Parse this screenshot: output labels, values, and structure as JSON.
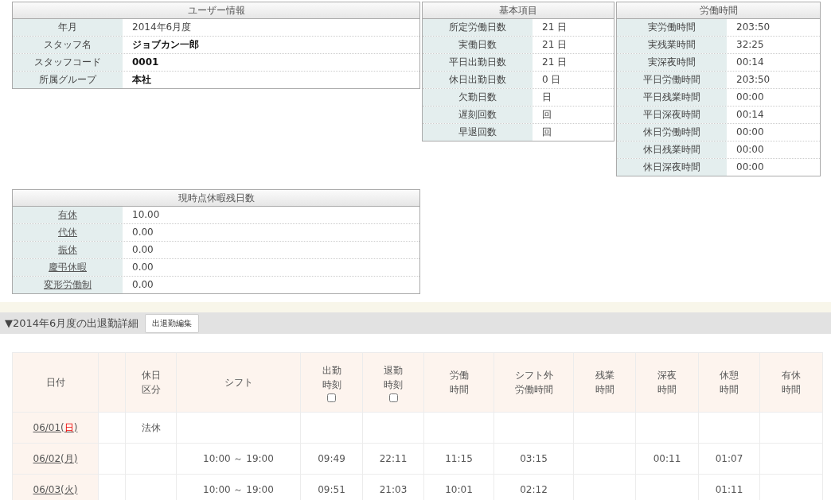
{
  "user_info": {
    "title": "ユーザー情報",
    "rows": [
      {
        "label": "年月",
        "value": "2014年6月度",
        "emphasized": false
      },
      {
        "label": "スタッフ名",
        "value": "ジョブカン一郎",
        "emphasized": true
      },
      {
        "label": "スタッフコード",
        "value": "0001",
        "emphasized": true
      },
      {
        "label": "所属グループ",
        "value": "本社",
        "emphasized": true
      }
    ]
  },
  "basic_items": {
    "title": "基本項目",
    "rows": [
      {
        "label": "所定労働日数",
        "value": "21 日"
      },
      {
        "label": "実働日数",
        "value": "21 日"
      },
      {
        "label": "平日出勤日数",
        "value": "21 日"
      },
      {
        "label": "休日出勤日数",
        "value": "0 日"
      },
      {
        "label": "欠勤日数",
        "value": "日"
      },
      {
        "label": "遅刻回数",
        "value": "回"
      },
      {
        "label": "早退回数",
        "value": "回"
      }
    ]
  },
  "working_hours": {
    "title": "労働時間",
    "rows": [
      {
        "label": "実労働時間",
        "value": "203:50"
      },
      {
        "label": "実残業時間",
        "value": "32:25"
      },
      {
        "label": "実深夜時間",
        "value": "00:14"
      },
      {
        "label": "平日労働時間",
        "value": "203:50"
      },
      {
        "label": "平日残業時間",
        "value": "00:00"
      },
      {
        "label": "平日深夜時間",
        "value": "00:14"
      },
      {
        "label": "休日労働時間",
        "value": "00:00"
      },
      {
        "label": "休日残業時間",
        "value": "00:00"
      },
      {
        "label": "休日深夜時間",
        "value": "00:00"
      }
    ]
  },
  "leave_balance": {
    "title": "現時点休暇残日数",
    "rows": [
      {
        "label": "有休",
        "value": "10.00"
      },
      {
        "label": "代休",
        "value": "0.00"
      },
      {
        "label": "振休",
        "value": "0.00"
      },
      {
        "label": "慶弔休暇",
        "value": "0.00"
      },
      {
        "label": "変形労働制",
        "value": "0.00"
      }
    ]
  },
  "attendance_section": {
    "title": "▼2014年6月度の出退勤詳細",
    "button": "出退勤編集"
  },
  "attendance_table": {
    "columns": [
      {
        "label": "日付"
      },
      {},
      {
        "label": "休日区分"
      },
      {
        "label": "シフト"
      },
      {
        "label": "出勤時刻",
        "checkbox": {
          "checked": false
        }
      },
      {
        "label": "退勤時刻",
        "checkbox": {
          "checked": false
        }
      },
      {
        "label": "労働時間"
      },
      {
        "label": "シフト外労働時間"
      },
      {
        "label": "残業時間"
      },
      {
        "label": "深夜時間"
      },
      {
        "label": "休憩時間"
      },
      {
        "label": "有休時間"
      }
    ],
    "rows": [
      {
        "cells": [
          {
            "prefix": "06/01(",
            "weekday": "日",
            "suffix": ")",
            "holiday": true
          },
          "",
          "法休",
          "",
          "",
          "",
          "",
          "",
          "",
          "",
          "",
          ""
        ]
      },
      {
        "cells": [
          {
            "prefix": "06/02(",
            "weekday": "月",
            "suffix": ")",
            "holiday": false
          },
          "",
          "",
          "10:00 ～ 19:00",
          "09:49",
          "22:11",
          "11:15",
          "03:15",
          "",
          "00:11",
          "01:07",
          ""
        ]
      },
      {
        "cells": [
          {
            "prefix": "06/03(",
            "weekday": "火",
            "suffix": ")",
            "holiday": false
          },
          "",
          "",
          "10:00 ～ 19:00",
          "09:51",
          "21:03",
          "10:01",
          "02:12",
          "",
          "",
          "01:11",
          ""
        ]
      }
    ]
  }
}
